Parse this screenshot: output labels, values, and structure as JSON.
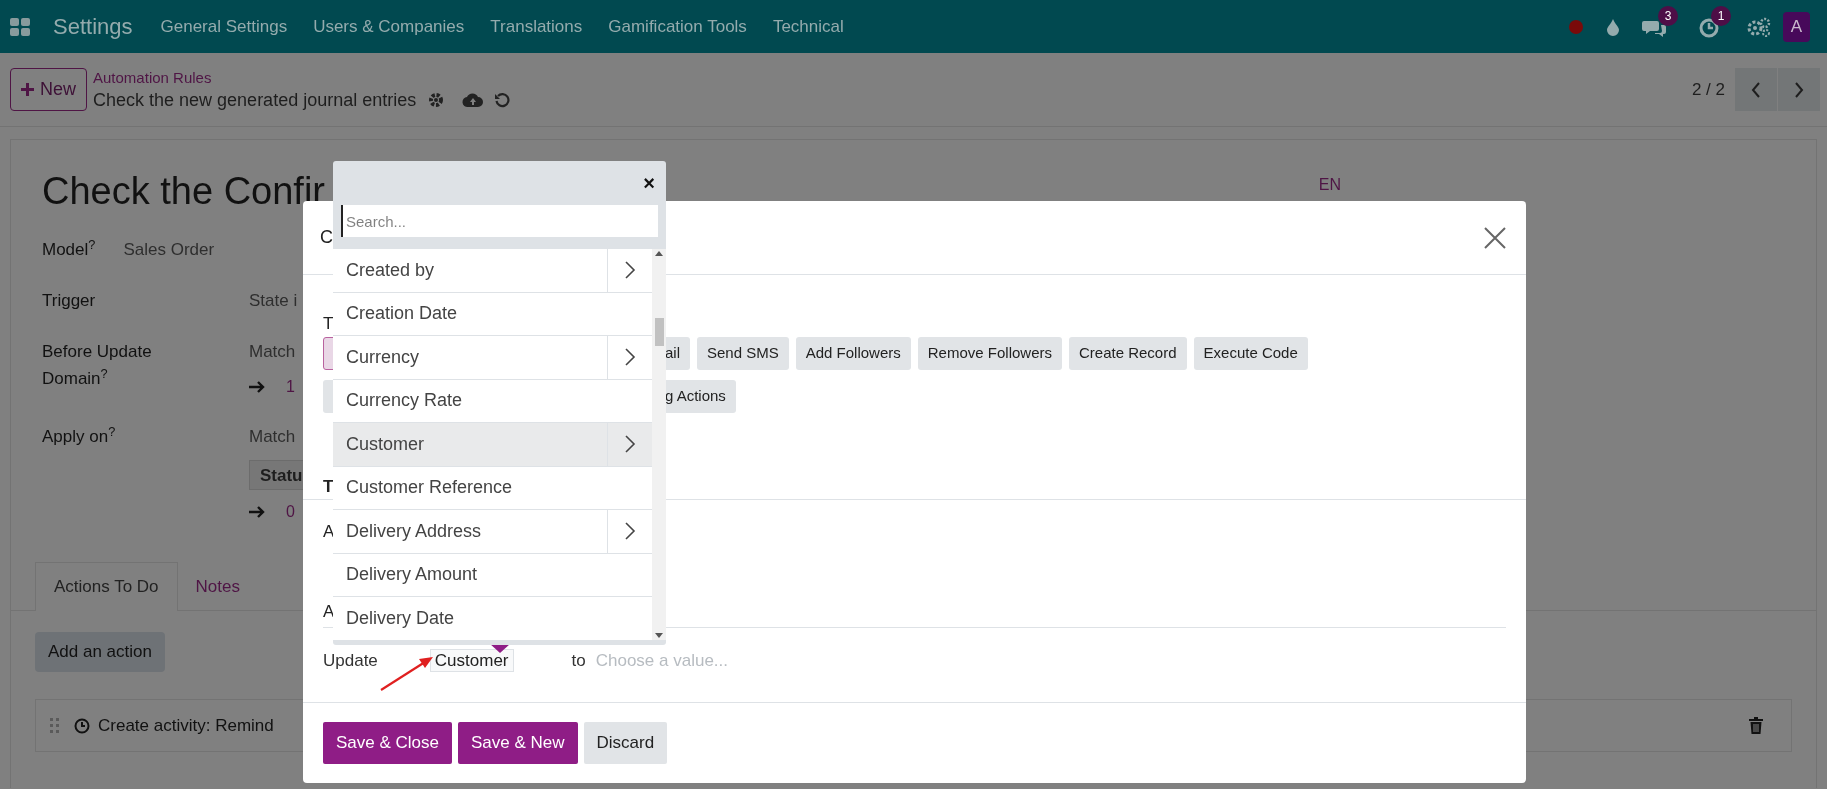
{
  "navbar": {
    "app": "Settings",
    "menus": [
      "General Settings",
      "Users & Companies",
      "Translations",
      "Gamification Tools",
      "Technical"
    ],
    "messages_badge": "3",
    "activities_badge": "1",
    "avatar": "A"
  },
  "control_panel": {
    "new_button": "New",
    "breadcrumb": "Automation Rules",
    "record_title": "Check the new generated journal entries",
    "pager": "2 / 2"
  },
  "form": {
    "title": "Check the Confir",
    "language": "EN",
    "fields": [
      {
        "kind": "inline",
        "label": "Model",
        "help": "?",
        "value": "Sales Order"
      },
      {
        "kind": "aligned",
        "label": "Trigger",
        "value": "State i"
      },
      {
        "kind": "aligned",
        "label": "Before Update Domain",
        "help": "?",
        "value": "Match",
        "count": "1"
      },
      {
        "kind": "aligned",
        "label": "Apply on",
        "help": "?",
        "value": "Match",
        "tag": "Statu",
        "count": "0"
      }
    ],
    "tabs": [
      {
        "label": "Actions To Do",
        "selected": true
      },
      {
        "label": "Notes",
        "selected": false
      }
    ],
    "add_button": "Add an action",
    "actions": [
      {
        "text": "Create activity: Remind"
      }
    ]
  },
  "modal": {
    "title": "C",
    "type_label": "T",
    "type_rows": [
      [
        {
          "selected": true
        },
        {
          "label": "ail",
          "selected": false
        },
        {
          "label": "Send SMS",
          "selected": false
        },
        {
          "label": "Add Followers",
          "selected": false
        },
        {
          "label": "Remove Followers",
          "selected": false
        },
        {
          "label": "Create Record",
          "selected": false
        },
        {
          "label": "Execute Code",
          "selected": false
        }
      ],
      [
        {
          "selected": false
        },
        {
          "label": "g Actions",
          "selected": false
        }
      ]
    ],
    "section_heading": "T",
    "labels": [
      "A",
      "A"
    ],
    "update_row": {
      "label": "Update",
      "field": "Customer",
      "to": "to",
      "placeholder": "Choose a value..."
    },
    "footer_buttons": [
      {
        "label": "Save & Close",
        "kind": "primary"
      },
      {
        "label": "Save & New",
        "kind": "primary"
      },
      {
        "label": "Discard",
        "kind": "secondary"
      }
    ]
  },
  "dropdown": {
    "close": "×",
    "search_placeholder": "Search...",
    "items": [
      {
        "label": "Created by",
        "has_children": true,
        "selected": false
      },
      {
        "label": "Creation Date",
        "has_children": false,
        "selected": false
      },
      {
        "label": "Currency",
        "has_children": true,
        "selected": false
      },
      {
        "label": "Currency Rate",
        "has_children": false,
        "selected": false
      },
      {
        "label": "Customer",
        "has_children": true,
        "selected": true
      },
      {
        "label": "Customer Reference",
        "has_children": false,
        "selected": false
      },
      {
        "label": "Delivery Address",
        "has_children": true,
        "selected": false
      },
      {
        "label": "Delivery Amount",
        "has_children": false,
        "selected": false
      },
      {
        "label": "Delivery Date",
        "has_children": false,
        "selected": false
      }
    ]
  }
}
